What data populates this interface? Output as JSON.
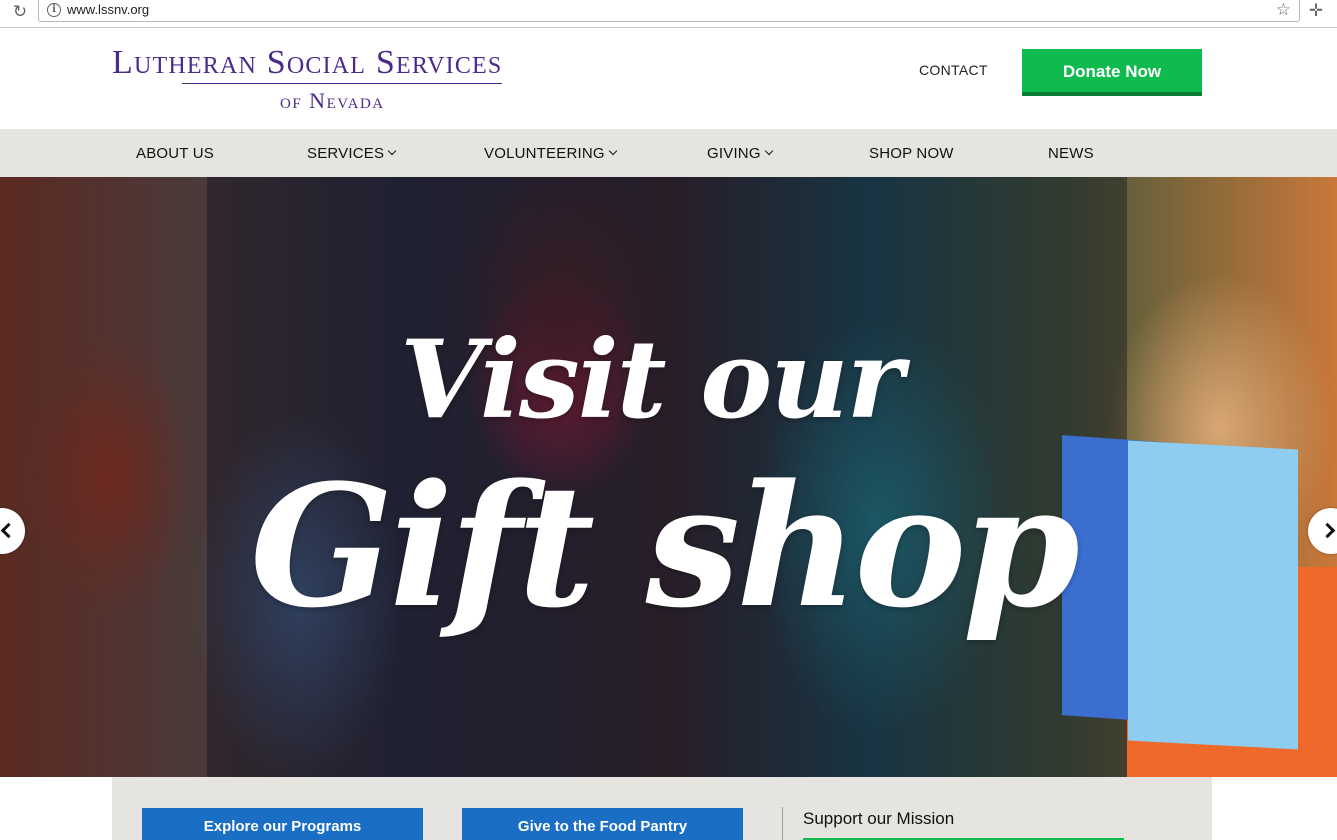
{
  "browser": {
    "url": "www.lssnv.org",
    "reload_icon": "reload-icon",
    "info_icon": "info-icon",
    "star_icon": "star-icon",
    "extension_icon": "extension-icon"
  },
  "header": {
    "logo_line1": "Lutheran Social Services",
    "logo_line2": "of Nevada",
    "contact_label": "CONTACT",
    "donate_label": "Donate Now"
  },
  "nav": {
    "items": [
      {
        "label": "ABOUT US",
        "has_dropdown": false
      },
      {
        "label": "SERVICES",
        "has_dropdown": true
      },
      {
        "label": "VOLUNTEERING",
        "has_dropdown": true
      },
      {
        "label": "GIVING",
        "has_dropdown": true
      },
      {
        "label": "SHOP NOW",
        "has_dropdown": false
      },
      {
        "label": "NEWS",
        "has_dropdown": false
      }
    ]
  },
  "hero": {
    "title_line1": "Visit our",
    "title_line2": "Gift shop"
  },
  "cta": {
    "programs_label": "Explore our Programs",
    "food_pantry_label": "Give to the Food Pantry",
    "mission_label": "Support our Mission"
  },
  "colors": {
    "brand_purple": "#4b2a8c",
    "donate_green": "#0fbb4e",
    "cta_blue": "#1a6fc4",
    "nav_bg": "#e6e4e0"
  }
}
